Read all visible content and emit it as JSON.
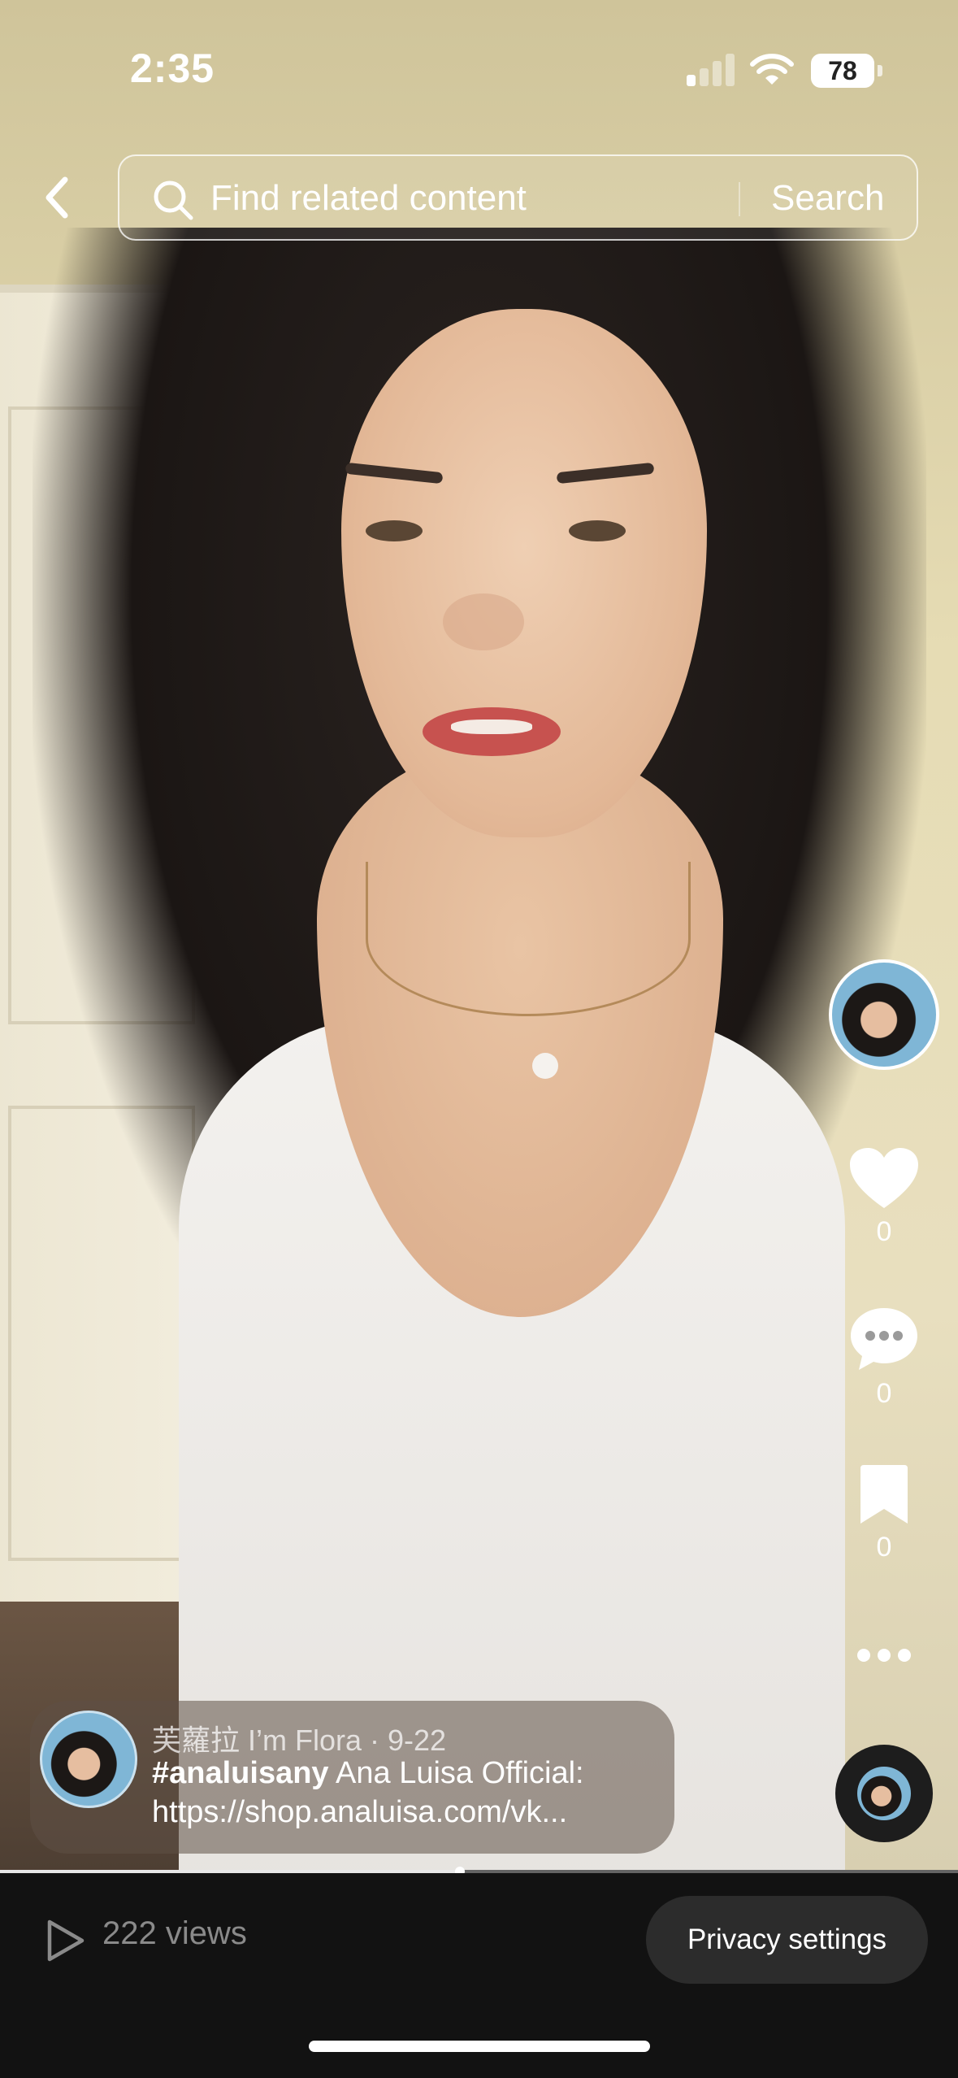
{
  "status_bar": {
    "time": "2:35",
    "battery": "78"
  },
  "search": {
    "placeholder": "Find related content",
    "button_label": "Search"
  },
  "actions": {
    "like_count": "0",
    "comment_count": "0",
    "bookmark_count": "0"
  },
  "caption": {
    "author": "芙蘿拉 I’m Flora · 9-22",
    "hashtag": "#analuisany",
    "text": "Ana Luisa Official:",
    "link": "https://shop.analuisa.com/vk..."
  },
  "playback": {
    "progress": 0.48
  },
  "footer": {
    "views": "222 views",
    "privacy_button": "Privacy settings"
  },
  "icons": [
    "back-icon",
    "search-icon",
    "heart-icon",
    "comment-icon",
    "bookmark-icon",
    "more-icon",
    "play-icon"
  ]
}
